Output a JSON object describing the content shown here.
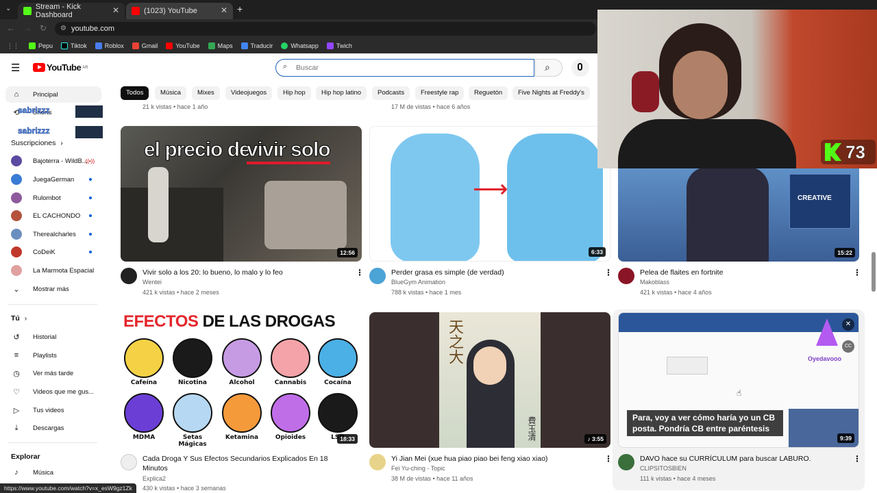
{
  "browser": {
    "tabs": [
      {
        "title": "Stream - Kick Dashboard"
      },
      {
        "title": "(1023) YouTube"
      }
    ],
    "url": "youtube.com",
    "bookmarks": [
      "Pepu",
      "Tiktok",
      "Roblox",
      "Gmail",
      "YouTube",
      "Maps",
      "Traducir",
      "Whatsapp",
      "Twich"
    ],
    "status_url": "https://www.youtube.com/watch?v=x_esW9gz1Zk"
  },
  "youtube": {
    "logo": "YouTube",
    "region": "AR",
    "search_placeholder": "Buscar",
    "chips": [
      "Todos",
      "Música",
      "Mixes",
      "Videojuegos",
      "Hip hop",
      "Hip hop latino",
      "Podcasts",
      "Freestyle rap",
      "Reguetón",
      "Five Nights at Freddy's"
    ]
  },
  "sidebar": {
    "principal": "Principal",
    "shorts": "Shorts",
    "subs_header": "Suscripciones",
    "subs": [
      {
        "name": "Bajoterra - WildB...",
        "badge": "live"
      },
      {
        "name": "JuegaGerman",
        "badge": "dot"
      },
      {
        "name": "Rulombot",
        "badge": "dot"
      },
      {
        "name": "EL CACHONDO",
        "badge": "dot"
      },
      {
        "name": "Therealcharles",
        "badge": "dot"
      },
      {
        "name": "CoDeiK",
        "badge": "dot"
      },
      {
        "name": "La Marmota Espacial",
        "badge": "dot"
      }
    ],
    "show_more": "Mostrar más",
    "you_header": "Tú",
    "you_items": [
      "Historial",
      "Playlists",
      "Ver más tarde",
      "Videos que me gus...",
      "Tus videos",
      "Descargas"
    ],
    "explore_header": "Explorar",
    "explore_items": [
      "Música"
    ]
  },
  "overlay": {
    "viewer_name": "sabrizzz",
    "kick_count": "73"
  },
  "top_meta": {
    "left": "21 k vistas • hace 1 año",
    "mid": "17 M de vistas • hace 6 años"
  },
  "videos_row1": [
    {
      "title": "Vivir solo a los 20: lo bueno, lo malo y lo feo",
      "channel": "Wentei",
      "meta": "421 k vistas • hace 2 meses",
      "duration": "12:56",
      "thumb_text_1": "el precio de",
      "thumb_text_2": "vivir solo"
    },
    {
      "title": "Perder grasa es simple (de verdad)",
      "channel": "BlueGym Animation",
      "meta": "788 k vistas • hace 1 mes",
      "duration": "6:33"
    },
    {
      "title": "Pelea de flaites en fortnite",
      "channel": "Makoblass",
      "meta": "421 k vistas • hace 4 años",
      "duration": "15:22",
      "thumb_text": "CREATIVE"
    }
  ],
  "videos_row2": [
    {
      "title": "Cada Droga Y Sus Efectos Secundarios Explicados En 18 Minutos",
      "channel": "Explica2",
      "meta": "430 k vistas • hace 3 semanas",
      "duration": "18:33",
      "thumb_heading_1": "EFECTOS",
      "thumb_heading_2": "DE LAS DROGAS",
      "drugs": [
        "Cafeína",
        "Nicotina",
        "Alcohol",
        "Cannabis",
        "Cocaína",
        "MDMA",
        "Setas Mágicas",
        "Ketamina",
        "Opioides",
        "LSD"
      ]
    },
    {
      "title": "Yi Jian Mei (xue hua piao piao bei feng xiao xiao)",
      "channel": "Fei Yu-ching - Topic",
      "meta": "38 M de vistas • hace 11 años",
      "duration": "3:55",
      "thumb_text": "天之大",
      "thumb_side": "費玉清"
    },
    {
      "title": "DAVO hace su CURRÍCULUM para buscar LABURO.",
      "channel": "CLIPSITOSBIEN",
      "meta": "111 k vistas • hace 4 meses",
      "duration": "9:39",
      "caption": "Para, voy a ver cómo haría yo un CB posta. Pondría CB entre paréntesis",
      "brand": "Oyedavooo"
    }
  ],
  "colors": {
    "accent_red": "#ff0000",
    "kick_green": "#53fc18",
    "link_blue": "#065fd4"
  }
}
